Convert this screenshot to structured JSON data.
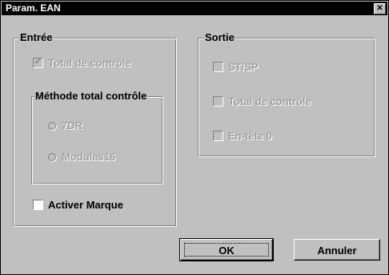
{
  "window": {
    "title": "Param. EAN",
    "close_glyph": "✕"
  },
  "entree": {
    "legend": "Entrée",
    "total_controle": {
      "label": "Total de contrôle",
      "checked": true,
      "enabled": false
    },
    "methode": {
      "legend": "Méthode total contrôle",
      "options": [
        {
          "label": "7DR",
          "enabled": false
        },
        {
          "label": "Modulas16",
          "enabled": false
        }
      ]
    },
    "activer_marque": {
      "label": "Activer Marque",
      "checked": false,
      "enabled": true
    }
  },
  "sortie": {
    "legend": "Sortie",
    "items": [
      {
        "label": "ST/SP",
        "checked": false,
        "enabled": false
      },
      {
        "label": "Total de contrôle",
        "checked": false,
        "enabled": false
      },
      {
        "label": "En-tête 0",
        "checked": false,
        "enabled": false
      }
    ]
  },
  "buttons": {
    "ok": "OK",
    "cancel": "Annuler"
  },
  "icons": {
    "check": "✓"
  }
}
